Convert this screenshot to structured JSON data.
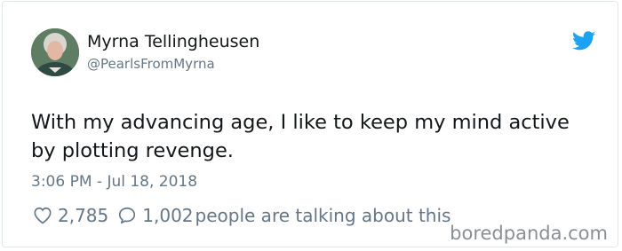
{
  "tweet": {
    "display_name": "Myrna Tellingheusen",
    "handle": "@PearlsFromMyrna",
    "text": "With my advancing age, I like to keep my mind active by plotting revenge.",
    "timestamp": "3:06 PM - Jul 18, 2018",
    "likes": "2,785",
    "replies": "1,002",
    "talking_text": "people are talking about this"
  },
  "icons": {
    "platform": "twitter-bird-icon",
    "like": "heart-icon",
    "reply": "reply-bubble-icon"
  },
  "watermark": "boredpanda.com",
  "colors": {
    "twitter_blue": "#1da1f2",
    "secondary_text": "#657786",
    "primary_text": "#14171a",
    "border": "#e1e8ed"
  }
}
